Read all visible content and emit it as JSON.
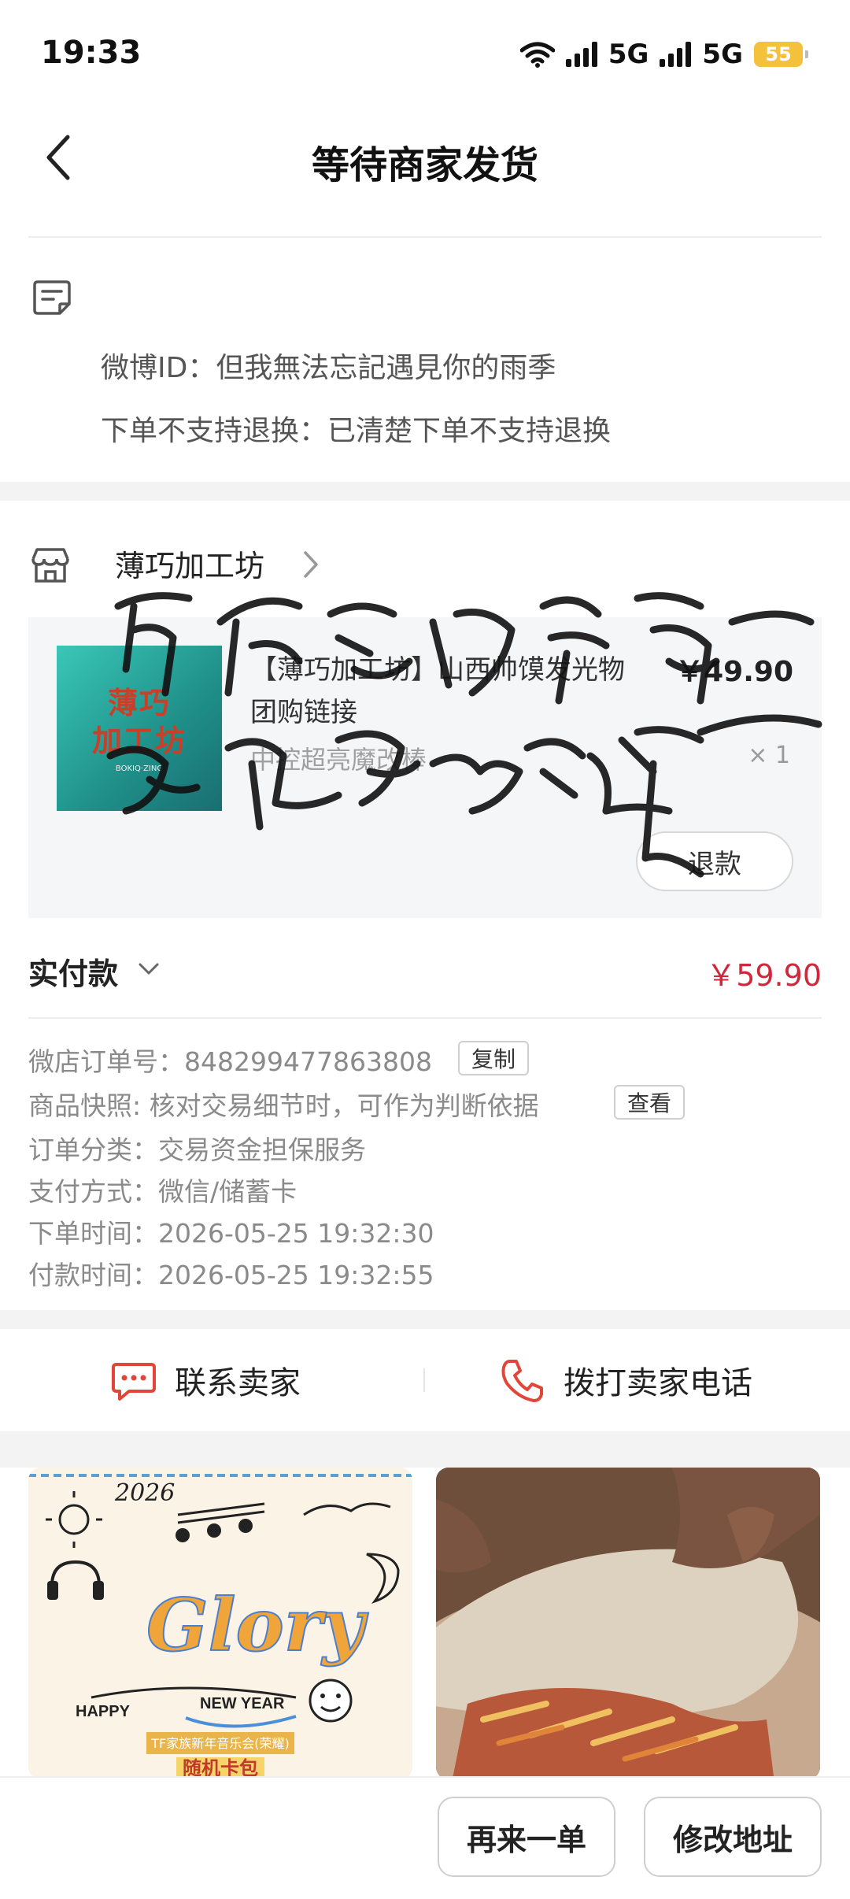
{
  "status_bar": {
    "time": "19:33",
    "network_1": "5G",
    "network_2": "5G",
    "battery": "55"
  },
  "nav": {
    "title": "等待商家发货",
    "back_icon": "chevron-left-icon"
  },
  "remark": {
    "icon": "note-icon",
    "line1": "微博ID：但我無法忘記遇見你的雨季",
    "line2": "下单不支持退换：已清楚下单不支持退换"
  },
  "shop": {
    "name": "薄巧加工坊",
    "icon": "store-icon"
  },
  "product": {
    "thumb_line1": "薄巧",
    "thumb_line2": "加工坊",
    "thumb_sub": "BOKIQ·ZING",
    "title": "【薄巧加工坊】山西帅馍发光物团购链接",
    "price": "￥49.90",
    "spec": "中控超亮魔改棒",
    "quantity": "× 1",
    "refund_label": "退款"
  },
  "signature_text": {
    "line1": "但我無法忘記",
    "line2": "遇見你的雨季"
  },
  "payment": {
    "label": "实付款",
    "amount": "￥59.90"
  },
  "order_info": {
    "order_no": "微店订单号：848299477863808",
    "copy_label": "复制",
    "snapshot": "商品快照: 核对交易细节时，可作为判断依据",
    "view_label": "查看",
    "category": "订单分类：交易资金担保服务",
    "pay_method": "支付方式：微信/储蓄卡",
    "order_time": "下单时间：2026-05-25 19:32:30",
    "pay_time": "付款时间：2026-05-25 19:32:55"
  },
  "contact": {
    "seller_label": "联系卖家",
    "call_label": "拨打卖家电话"
  },
  "recommend": {
    "left_year": "2026",
    "left_brand": "Glory",
    "left_happy": "HAPPY",
    "left_new_year": "NEW YEAR",
    "left_caption": "TF家族新年音乐会(荣耀)",
    "left_tag": "随机卡包"
  },
  "bottom": {
    "reorder_label": "再来一单",
    "edit_address_label": "修改地址"
  },
  "colors": {
    "price_red": "#d0273b",
    "accent_red": "#e0473a",
    "battery": "#f4c23a"
  }
}
